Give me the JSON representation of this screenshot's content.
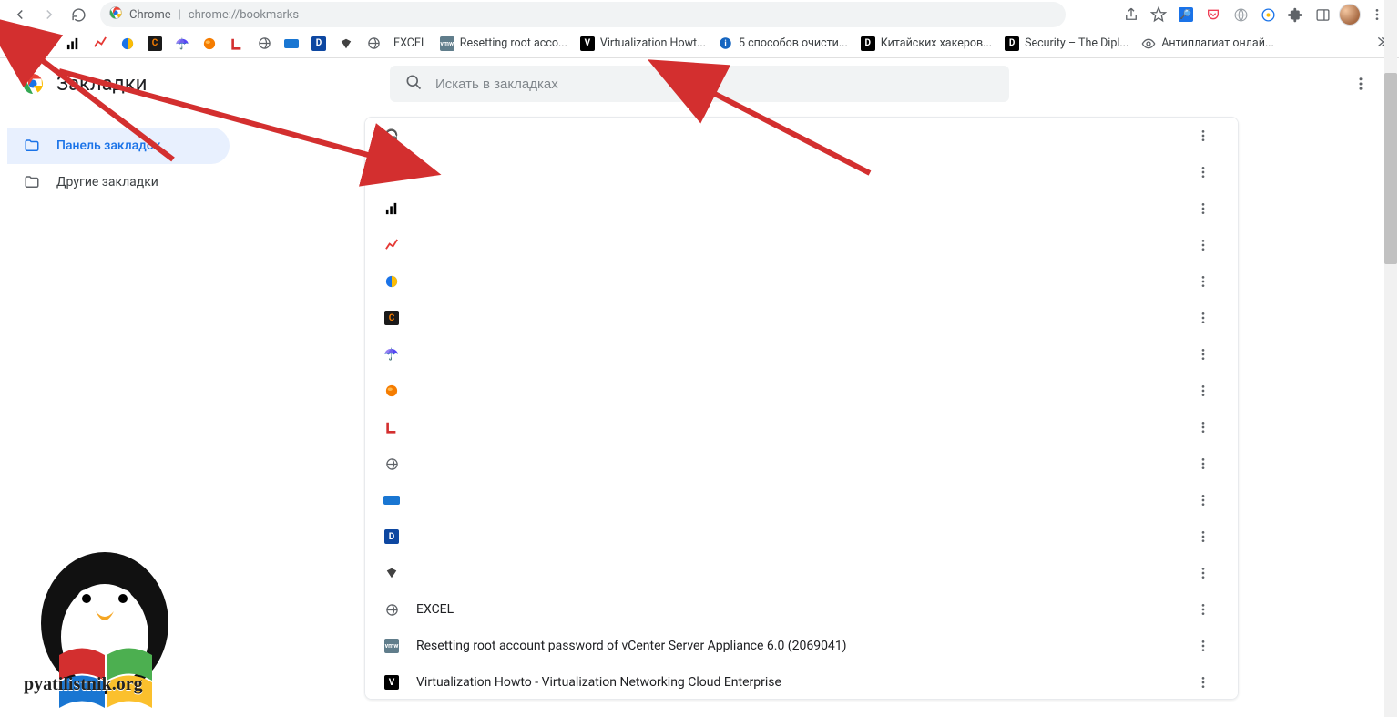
{
  "browser": {
    "url_prefix": "Chrome",
    "url_path": "chrome://bookmarks"
  },
  "bookmarks_bar": {
    "items": [
      {
        "label": ""
      },
      {
        "label": ""
      },
      {
        "label": ""
      },
      {
        "label": ""
      },
      {
        "label": ""
      },
      {
        "label": ""
      },
      {
        "label": ""
      },
      {
        "label": ""
      },
      {
        "label": ""
      },
      {
        "label": ""
      },
      {
        "label": ""
      },
      {
        "label": ""
      },
      {
        "label": ""
      },
      {
        "label": ""
      },
      {
        "label": "EXCEL"
      },
      {
        "label": "Resetting root acco..."
      },
      {
        "label": "Virtualization Howt..."
      },
      {
        "label": "5 способов очисти..."
      },
      {
        "label": "Китайских хакеров..."
      },
      {
        "label": "Security – The Dipl..."
      },
      {
        "label": "Антиплагиат онлай..."
      }
    ]
  },
  "page": {
    "title": "Закладки",
    "search_placeholder": "Искать в закладках"
  },
  "sidebar": {
    "items": [
      {
        "label": "Панель закладок",
        "active": true
      },
      {
        "label": "Другие закладки",
        "active": false
      }
    ]
  },
  "list": {
    "items": [
      {
        "label": ""
      },
      {
        "label": ""
      },
      {
        "label": ""
      },
      {
        "label": ""
      },
      {
        "label": ""
      },
      {
        "label": ""
      },
      {
        "label": ""
      },
      {
        "label": ""
      },
      {
        "label": ""
      },
      {
        "label": ""
      },
      {
        "label": ""
      },
      {
        "label": ""
      },
      {
        "label": ""
      },
      {
        "label": "EXCEL"
      },
      {
        "label": "Resetting root account password of vCenter Server Appliance 6.0 (2069041)"
      },
      {
        "label": "Virtualization Howto - Virtualization Networking Cloud Enterprise"
      }
    ]
  },
  "watermark": {
    "text": "pyatilistnik.org"
  }
}
